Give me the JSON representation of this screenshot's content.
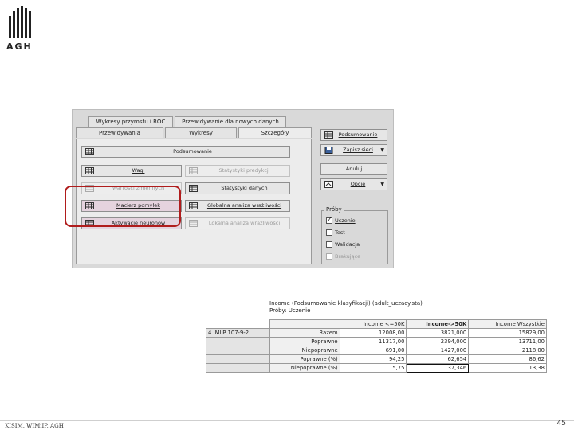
{
  "brand": {
    "logo_text": "AGH"
  },
  "footer": {
    "left": "KISIM, WIMiIP, AGH",
    "page": "45"
  },
  "dialog": {
    "tabs_back": [
      "Wykresy przyrostu i ROC",
      "Przewidywanie dla nowych danych"
    ],
    "tabs_front": [
      "Przewidywania",
      "Wykresy",
      "Szczegóły"
    ],
    "active_tab": "Szczegóły",
    "buttons": {
      "summary_wide": "Podsumowanie",
      "weights": "Wagi",
      "pred_stats": "Statystyki predykcji",
      "hidden_left": "Wartości zmiennych",
      "data_stats": "Statystyki danych",
      "confusion": "Macierz pomyłek",
      "global_sens": "Globalna analiza wrażliwości",
      "activations": "Aktywacje neuronów",
      "local_sens": "Lokalna analiza wrażliwości"
    },
    "right": {
      "summary": "Podsumowanie",
      "save": "Zapisz sieci",
      "cancel": "Anuluj",
      "options": "Opcje"
    },
    "samples": {
      "title": "Próby",
      "items": [
        {
          "label": "Uczenie",
          "checked": true,
          "enabled": true
        },
        {
          "label": "Test",
          "checked": false,
          "enabled": true
        },
        {
          "label": "Walidacja",
          "checked": false,
          "enabled": true
        },
        {
          "label": "Brakujące",
          "checked": false,
          "enabled": false
        }
      ]
    }
  },
  "results": {
    "title_line1": "Income (Podsumowanie klasyfikacji) (adult_uczacy.sta)",
    "title_line2": "Próby: Uczenie",
    "stub_label": "4. MLP 107-9-2",
    "columns": [
      "Income <=50K",
      "Income->50K",
      "Income Wszystkie"
    ],
    "rows": [
      {
        "label": "Razem",
        "values": [
          "12008,00",
          "3821,000",
          "15829,00"
        ]
      },
      {
        "label": "Poprawne",
        "values": [
          "11317,00",
          "2394,000",
          "13711,00"
        ]
      },
      {
        "label": "Niepoprawne",
        "values": [
          "691,00",
          "1427,000",
          "2118,00"
        ]
      },
      {
        "label": "Poprawne (%)",
        "values": [
          "94,25",
          "62,654",
          "86,62"
        ]
      },
      {
        "label": "Niepoprawne (%)",
        "values": [
          "5,75",
          "37,346",
          "13,38"
        ]
      }
    ]
  }
}
